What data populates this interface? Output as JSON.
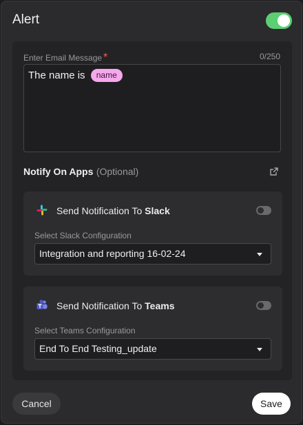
{
  "header": {
    "title": "Alert",
    "alert_enabled": true
  },
  "email": {
    "label": "Enter Email Message",
    "required_mark": "*",
    "counter": "0/250",
    "message_text": "The name is",
    "variable_chip": "name"
  },
  "notify": {
    "title": "Notify On Apps",
    "optional": "(Optional)"
  },
  "slack": {
    "title_prefix": "Send Notification To",
    "app_name": "Slack",
    "enabled": false,
    "select_label": "Select Slack Configuration",
    "selected": "Integration and reporting 16-02-24"
  },
  "teams": {
    "title_prefix": "Send Notification To",
    "app_name": "Teams",
    "enabled": false,
    "select_label": "Select Teams Configuration",
    "selected": "End To End Testing_update"
  },
  "footer": {
    "cancel_label": "Cancel",
    "save_label": "Save"
  },
  "colors": {
    "toggle_on": "#5ccf73",
    "chip_bg": "#f6a8ec",
    "required": "#ff5a5a"
  }
}
